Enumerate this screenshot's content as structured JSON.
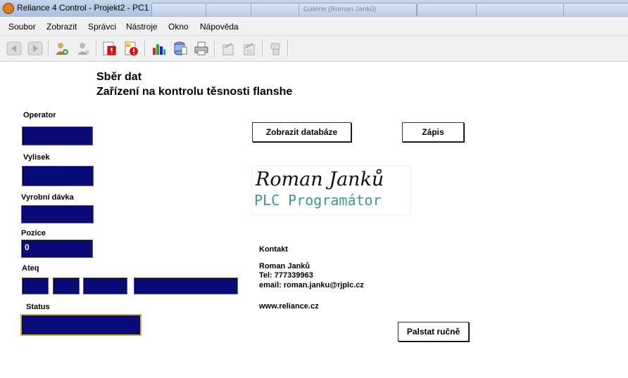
{
  "window": {
    "title": "Reliance 4 Control - Projekt2 - PC1",
    "tabs": [
      "",
      "",
      "",
      "Galerie (Roman Janků)",
      "",
      "",
      ""
    ]
  },
  "menu": [
    "Soubor",
    "Zobrazit",
    "Správci",
    "Nástroje",
    "Okno",
    "Nápověda"
  ],
  "toolbar": {
    "icons": [
      "back-icon",
      "forward-icon",
      "add-user-icon",
      "user-icon",
      "alarm-icon",
      "alarm-warning-icon",
      "chart-icon",
      "database-icon",
      "printer-icon",
      "report-icon",
      "report-edit-icon",
      "recipe-icon"
    ]
  },
  "main": {
    "title": "Sběr dat",
    "subtitle": "Zařízení na kontrolu těsnosti flanshe",
    "fields": {
      "operator_label": "Operator",
      "operator_value": "",
      "vylisek_label": "Vylisek",
      "vylisek_value": "",
      "davka_label": "Vyrobní dávka",
      "davka_value": "",
      "pozice_label": "Pozice",
      "pozice_value": "0",
      "ateq_label": "Ateq",
      "status_label": "Status",
      "status_value": ""
    },
    "buttons": {
      "database": "Zobrazit databáze",
      "write": "Zápis",
      "stamp": "Palstat ručně"
    },
    "logo": {
      "name": "Roman Janků",
      "role": "PLC Programátor"
    },
    "contact": {
      "heading": "Kontakt",
      "name": "Roman Janků",
      "tel": "Tel: 777339963",
      "email": "email: roman.janku@rjplc.cz",
      "web": "www.reliance.cz"
    }
  },
  "colors": {
    "field_bg": "#0a0a78",
    "status_border": "#c8b040",
    "logo_role": "#3a9a8a"
  }
}
